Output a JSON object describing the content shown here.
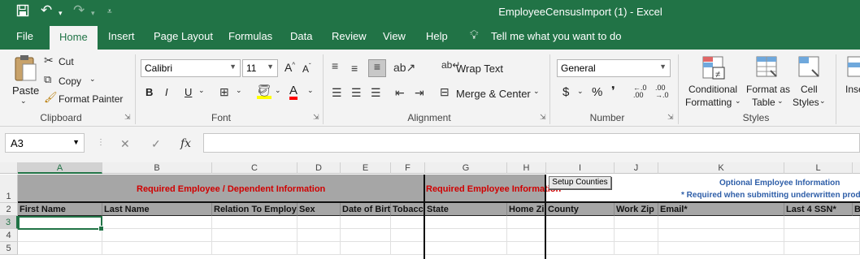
{
  "titlebar": {
    "title": "EmployeeCensusImport (1)  -  Excel",
    "save_icon": "save-icon",
    "undo_icon": "undo-icon",
    "redo_icon": "redo-icon",
    "customize_icon": "customize-qat-icon"
  },
  "tabs": [
    "File",
    "Home",
    "Insert",
    "Page Layout",
    "Formulas",
    "Data",
    "Review",
    "View",
    "Help"
  ],
  "active_tab": "Home",
  "tell_me": "Tell me what you want to do",
  "ribbon": {
    "clipboard": {
      "paste": "Paste",
      "cut": "Cut",
      "copy": "Copy",
      "format_painter": "Format Painter",
      "label": "Clipboard"
    },
    "font": {
      "name": "Calibri",
      "size": "11",
      "label": "Font",
      "bold": "B",
      "italic": "I",
      "underline": "U",
      "font_color": "A"
    },
    "alignment": {
      "wrap_text": "Wrap Text",
      "merge_center": "Merge & Center",
      "label": "Alignment"
    },
    "number": {
      "format": "General",
      "currency": "$",
      "percent": "%",
      "label": "Number"
    },
    "styles": {
      "conditional": "Conditional",
      "conditional2": "Formatting",
      "format_as": "Format as",
      "table": "Table",
      "cell": "Cell",
      "styles": "Styles",
      "label": "Styles"
    },
    "insert_partial": "Inse"
  },
  "formula_bar": {
    "name_box": "A3",
    "fx": "fx",
    "cancel": "✕",
    "enter": "✓",
    "value": ""
  },
  "sheet": {
    "columns": [
      "A",
      "B",
      "C",
      "D",
      "E",
      "F",
      "G",
      "H",
      "I",
      "J",
      "K",
      "L"
    ],
    "rows": [
      "1",
      "2",
      "3",
      "4",
      "5"
    ],
    "selected_col": "A",
    "selected_row": "3",
    "band1": "Required Employee / Dependent Information",
    "band2": "Required Employee Information",
    "setup_button": "Setup Counties",
    "optional_title": "Optional Employee Information",
    "optional_note": "* Required when submitting underwritten prod",
    "headers": [
      "First Name",
      "Last Name",
      "Relation To Employee",
      "Sex",
      "Date of Birth",
      "Tobacco",
      "State",
      "Home Zip",
      "County",
      "Work Zip",
      "Email*",
      "Last 4 SSN*",
      "B"
    ]
  },
  "colors": {
    "excel_green": "#217346",
    "header_gray": "#a6a6a6",
    "required_red": "#d00000",
    "optional_blue": "#2e5ea8"
  }
}
